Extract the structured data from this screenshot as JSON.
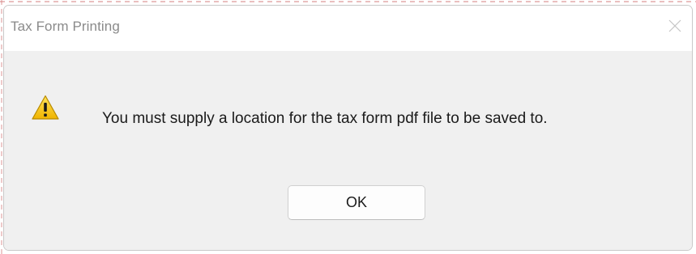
{
  "dialog": {
    "title": "Tax Form Printing",
    "close_icon": "close-icon",
    "icon": "warning-icon",
    "message": "You must supply a location for the tax form pdf file to be saved to.",
    "ok_label": "OK"
  },
  "colors": {
    "content_bg": "#f0f0f0",
    "titlebar_bg": "#ffffff",
    "warning_yellow": "#f2c200",
    "title_text": "#8a8a8a"
  }
}
